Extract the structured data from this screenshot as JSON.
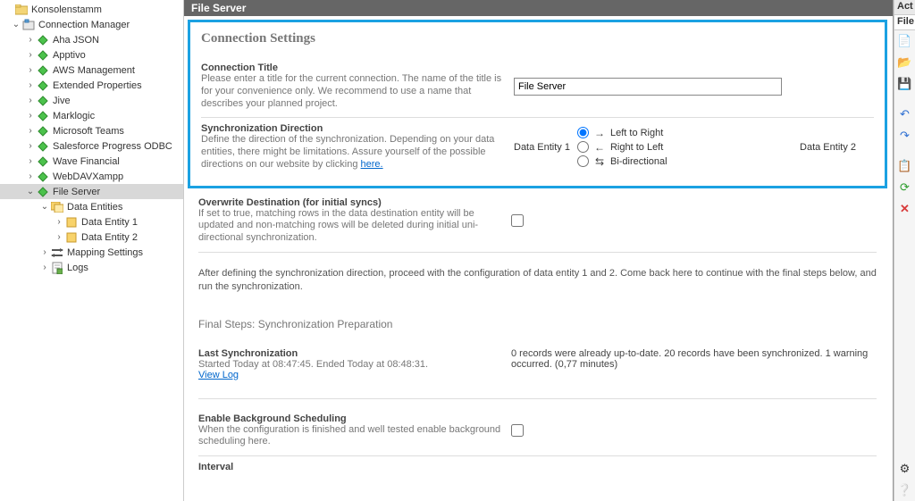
{
  "tree": {
    "root": "Konsolenstamm",
    "manager": "Connection Manager",
    "items": [
      "Aha JSON",
      "Apptivo",
      "AWS Management",
      "Extended Properties",
      "Jive",
      "Marklogic",
      "Microsoft Teams",
      "Salesforce Progress ODBC",
      "Wave Financial",
      "WebDAVXampp"
    ],
    "selected": "File Server",
    "sub": {
      "data_entities": "Data Entities",
      "e1": "Data Entity 1",
      "e2": "Data Entity 2",
      "mapping": "Mapping Settings",
      "logs": "Logs"
    }
  },
  "header": "File Server",
  "section_title": "Connection Settings",
  "conn_title": {
    "t": "Connection Title",
    "d": "Please enter a title for the current connection. The name of the title is for your convenience only. We recommend to use a name that describes your planned project.",
    "value": "File Server"
  },
  "sync": {
    "t": "Synchronization Direction",
    "d1": "Define the direction of the synchronization. Depending on your data entities, there might be limitations. Assure yourself of the possible directions on our website by clicking ",
    "link": "here.",
    "left": "Data Entity 1",
    "right": "Data Entity 2",
    "o1": "Left to Right",
    "o2": "Right to Left",
    "o3": "Bi-directional"
  },
  "overwrite": {
    "t": "Overwrite Destination (for initial syncs)",
    "d": "If set to true, matching rows in the data destination entity will be updated and non-matching rows will be deleted during initial uni-directional synchronization."
  },
  "note": "After defining the synchronization direction, proceed with the configuration of data entity 1 and 2. Come back here to continue with the final steps below, and run the synchronization.",
  "final": "Final Steps: Synchronization Preparation",
  "last": {
    "t": "Last Synchronization",
    "d": "Started  Today at 08:47:45. Ended Today at 08:48:31.",
    "link": "View Log",
    "r": "0 records were already up-to-date. 20 records have been synchronized. 1 warning occurred. (0,77 minutes)"
  },
  "bg": {
    "t": "Enable Background Scheduling",
    "d": "When the configuration is finished and well tested enable background scheduling here."
  },
  "interval": "Interval",
  "rp": {
    "act": "Act",
    "file": "File"
  }
}
